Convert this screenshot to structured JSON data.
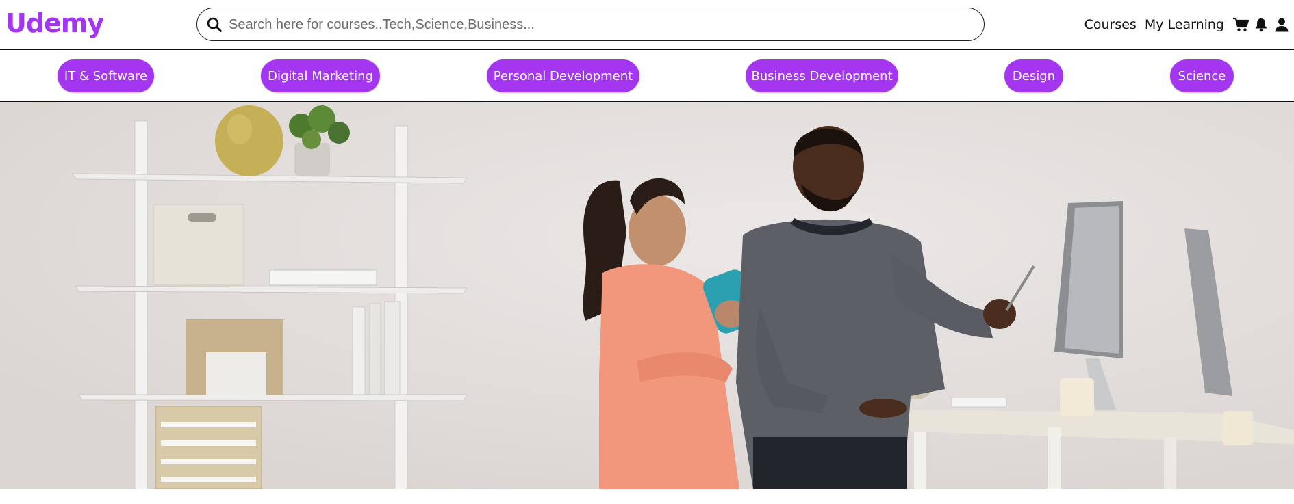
{
  "header": {
    "logo": "Udemy",
    "search": {
      "placeholder": "Search here for courses..Tech,Science,Business..."
    },
    "nav": {
      "courses": "Courses",
      "my_learning": "My Learning"
    },
    "icons": [
      "search-icon",
      "cart-icon",
      "bell-icon",
      "user-icon"
    ]
  },
  "categories": [
    "IT & Software",
    "Digital Marketing",
    "Personal Development",
    "Business Development",
    "Design",
    "Science"
  ],
  "colors": {
    "accent": "#a435f0",
    "text": "#111111",
    "background": "#ffffff"
  }
}
